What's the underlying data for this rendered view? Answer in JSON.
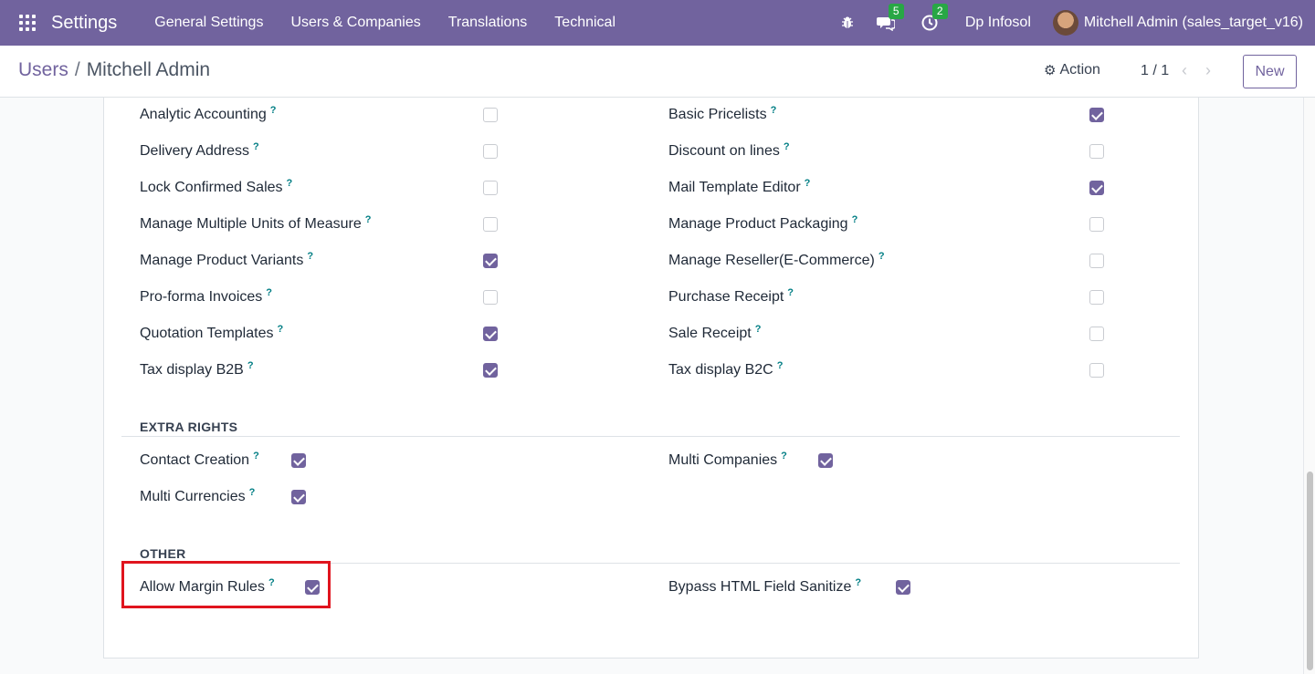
{
  "topbar": {
    "brand": "Settings",
    "menu": [
      "General Settings",
      "Users & Companies",
      "Translations",
      "Technical"
    ],
    "messages_badge": "5",
    "activity_badge": "2",
    "company": "Dp Infosol",
    "user": "Mitchell Admin (sales_target_v16)"
  },
  "control": {
    "breadcrumb_parent": "Users",
    "breadcrumb_sep": "/",
    "breadcrumb_current": "Mitchell Admin",
    "action": "Action",
    "pager": "1 / 1",
    "new": "New"
  },
  "technical_left": [
    {
      "label": "Analytic Accounting",
      "checked": false
    },
    {
      "label": "Delivery Address",
      "checked": false
    },
    {
      "label": "Lock Confirmed Sales",
      "checked": false
    },
    {
      "label": "Manage Multiple Units of Measure",
      "checked": false
    },
    {
      "label": "Manage Product Variants",
      "checked": true
    },
    {
      "label": "Pro-forma Invoices",
      "checked": false
    },
    {
      "label": "Quotation Templates",
      "checked": true
    },
    {
      "label": "Tax display B2B",
      "checked": true
    }
  ],
  "technical_right": [
    {
      "label": "Basic Pricelists",
      "checked": true
    },
    {
      "label": "Discount on lines",
      "checked": false
    },
    {
      "label": "Mail Template Editor",
      "checked": true
    },
    {
      "label": "Manage Product Packaging",
      "checked": false
    },
    {
      "label": "Manage Reseller(E-Commerce)",
      "checked": false
    },
    {
      "label": "Purchase Receipt",
      "checked": false
    },
    {
      "label": "Sale Receipt",
      "checked": false
    },
    {
      "label": "Tax display B2C",
      "checked": false
    }
  ],
  "extra_rights": {
    "title": "EXTRA RIGHTS",
    "items": [
      {
        "label": "Contact Creation",
        "checked": true
      },
      {
        "label": "Multi Companies",
        "checked": true
      },
      {
        "label": "Multi Currencies",
        "checked": true
      }
    ]
  },
  "other": {
    "title": "OTHER",
    "items": [
      {
        "label": "Allow Margin Rules",
        "checked": true
      },
      {
        "label": "Bypass HTML Field Sanitize",
        "checked": true
      }
    ]
  },
  "help_mark": "?"
}
